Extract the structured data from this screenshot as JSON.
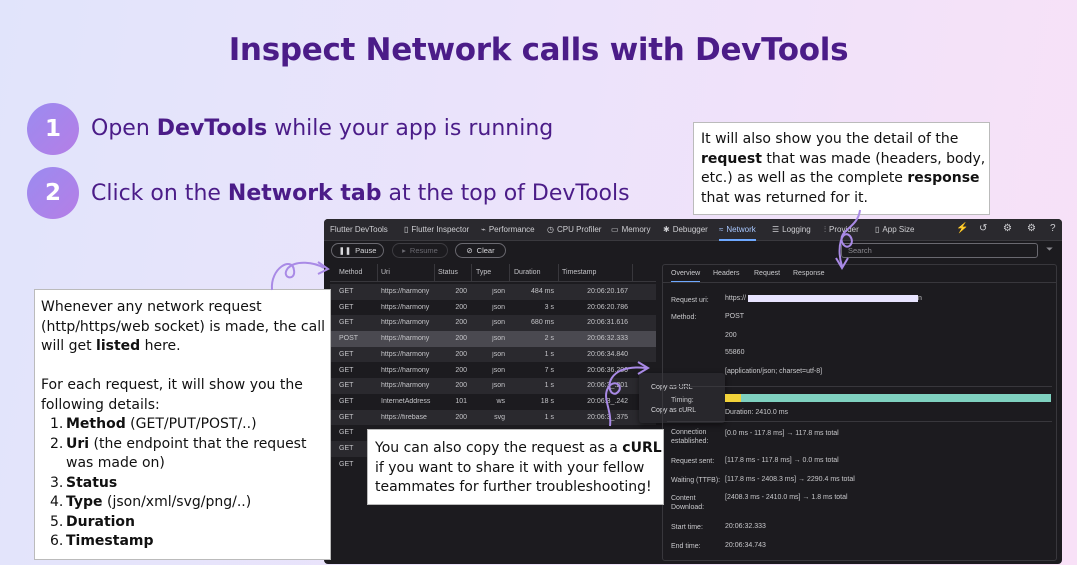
{
  "title": "Inspect Network calls with DevTools",
  "steps": [
    {
      "number": "1",
      "pre": "Open ",
      "bold": "DevTools",
      "post": " while your app is running"
    },
    {
      "number": "2",
      "pre": "Click on the ",
      "bold": "Network tab",
      "post": " at the top of DevTools"
    }
  ],
  "callout_top": {
    "l1": "It will also show you the detail of the",
    "l2_bold": "request",
    "l2": " that was made (headers, body,",
    "l3": "etc.) as well as the complete ",
    "l3_bold": "response",
    "l4": "that was returned for it."
  },
  "callout_left": {
    "p1_l1": "Whenever any network request",
    "p1_l2": "(http/https/web socket) is made, the call",
    "p1_l3": "will get ",
    "p1_l3_bold": "listed",
    "p1_l3_end": " here.",
    "p2_l1": "For each request, it will show you the",
    "p2_l2": "following details:",
    "items": [
      {
        "num": "1.",
        "bold": "Method",
        "text": " (GET/PUT/POST/..)"
      },
      {
        "num": "2.",
        "bold": "Uri",
        "text": " (the endpoint that the request",
        "cont": "was made on)"
      },
      {
        "num": "3.",
        "bold": "Status",
        "text": ""
      },
      {
        "num": "4.",
        "bold": "Type",
        "text": " (json/xml/svg/png/..)"
      },
      {
        "num": "5.",
        "bold": "Duration",
        "text": ""
      },
      {
        "num": "6.",
        "bold": "Timestamp",
        "text": ""
      }
    ]
  },
  "callout_curl": {
    "l1": "You can also copy the request as a ",
    "l1_bold": "cURL",
    "l2": "if you want to share it with your fellow",
    "l3": "teammates for further troubleshooting!"
  },
  "devtools": {
    "brand": "Flutter DevTools",
    "tabs": [
      "Flutter Inspector",
      "Performance",
      "CPU Profiler",
      "Memory",
      "Debugger",
      "Network",
      "Logging",
      "Provider",
      "App Size"
    ],
    "active_tab": "Network",
    "pause": "Pause",
    "resume": "Resume",
    "clear": "Clear",
    "search_placeholder": "Search",
    "columns": [
      "Method",
      "Uri",
      "Status",
      "Type",
      "Duration",
      "Timestamp"
    ],
    "rows": [
      {
        "method": "GET",
        "uri": "https://harmony",
        "status": "200",
        "type": "json",
        "duration": "484 ms",
        "timestamp": "20:06:20.167"
      },
      {
        "method": "GET",
        "uri": "https://harmony",
        "status": "200",
        "type": "json",
        "duration": "3 s",
        "timestamp": "20:06:20.786"
      },
      {
        "method": "GET",
        "uri": "https://harmony",
        "status": "200",
        "type": "json",
        "duration": "680 ms",
        "timestamp": "20:06:31.616"
      },
      {
        "method": "POST",
        "uri": "https://harmony",
        "status": "200",
        "type": "json",
        "duration": "2 s",
        "timestamp": "20:06:32.333"
      },
      {
        "method": "GET",
        "uri": "https://harmony",
        "status": "200",
        "type": "json",
        "duration": "1 s",
        "timestamp": "20:06:34.840"
      },
      {
        "method": "GET",
        "uri": "https://harmony",
        "status": "200",
        "type": "json",
        "duration": "7 s",
        "timestamp": "20:06:36.200"
      },
      {
        "method": "GET",
        "uri": "https://harmony",
        "status": "200",
        "type": "json",
        "duration": "1 s",
        "timestamp": "20:06:3_.201"
      },
      {
        "method": "GET",
        "uri": "InternetAddress",
        "status": "101",
        "type": "ws",
        "duration": "18 s",
        "timestamp": "20:06:3_.242"
      },
      {
        "method": "GET",
        "uri": "https://firebase",
        "status": "200",
        "type": "svg",
        "duration": "1 s",
        "timestamp": "20:06:3_.375"
      },
      {
        "method": "GET",
        "uri": "",
        "status": "",
        "type": "",
        "duration": "",
        "timestamp": ""
      },
      {
        "method": "GET",
        "uri": "",
        "status": "",
        "type": "",
        "duration": "",
        "timestamp": ""
      },
      {
        "method": "GET",
        "uri": "",
        "status": "",
        "type": "",
        "duration": "",
        "timestamp": ""
      }
    ],
    "context_menu": [
      "Copy as URL",
      "Copy as cURL"
    ],
    "detail_tabs": [
      "Overview",
      "Headers",
      "Request",
      "Response"
    ],
    "active_detail_tab": "Overview",
    "request_uri_label": "Request uri:",
    "request_uri_value": "https://",
    "request_uri_tail": "n",
    "method_label": "Method:",
    "method_value": "POST",
    "status_value": "200",
    "port_value": "55860",
    "content_type_value": "[application/json; charset=utf-8]",
    "timing_label": "Timing:",
    "duration_text": "Duration: 2410.0 ms",
    "timing_bar_fraction_yellow": 0.049,
    "timing_rows": [
      {
        "label": "Connection established:",
        "value": "[0.0 ms - 117.8 ms] → 117.8 ms total"
      },
      {
        "label": "Request sent:",
        "value": "[117.8 ms - 117.8 ms] → 0.0 ms total"
      },
      {
        "label": "Waiting (TTFB):",
        "value": "[117.8 ms - 2408.3 ms] → 2290.4 ms total"
      },
      {
        "label": "Content Download:",
        "value": "[2408.3 ms - 2410.0 ms] → 1.8 ms total"
      }
    ],
    "start_label": "Start time:",
    "start_value": "20:06:32.333",
    "end_label": "End time:",
    "end_value": "20:06:34.743"
  },
  "colors": {
    "title": "#4b1c88",
    "accent_blue": "#6ea8ff",
    "timing_yellow": "#f2d33a",
    "timing_teal": "#7fd1c0",
    "request_uri_highlight": "#e8e4ff"
  }
}
